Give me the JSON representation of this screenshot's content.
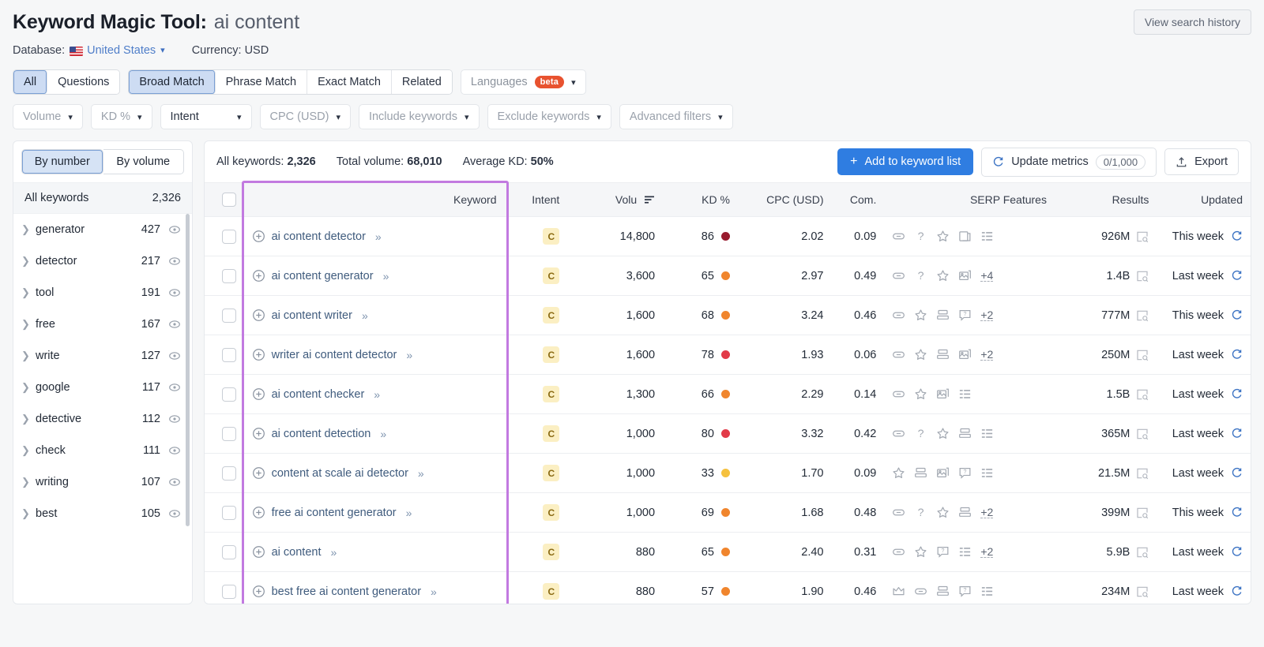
{
  "header": {
    "title_main": "Keyword Magic Tool:",
    "title_query": "ai content",
    "database_label": "Database:",
    "database_value": "United States",
    "currency_label": "Currency: USD",
    "search_history_button": "View search history",
    "flag_icon": "us-flag-icon"
  },
  "filters": {
    "match_tabs": [
      {
        "label": "All",
        "active": true
      },
      {
        "label": "Questions",
        "active": false
      }
    ],
    "match_types": [
      {
        "label": "Broad Match",
        "active": true
      },
      {
        "label": "Phrase Match",
        "active": false
      },
      {
        "label": "Exact Match",
        "active": false
      },
      {
        "label": "Related",
        "active": false
      }
    ],
    "languages": {
      "label": "Languages",
      "badge": "beta"
    },
    "dropdowns": [
      {
        "label": "Volume"
      },
      {
        "label": "KD %"
      },
      {
        "label": "Intent"
      },
      {
        "label": "CPC (USD)"
      },
      {
        "label": "Include keywords"
      },
      {
        "label": "Exclude keywords"
      },
      {
        "label": "Advanced filters"
      }
    ]
  },
  "sidebar": {
    "toggle": [
      {
        "label": "By number",
        "active": true
      },
      {
        "label": "By volume",
        "active": false
      }
    ],
    "all_keywords_label": "All keywords",
    "all_keywords_count": "2,326",
    "items": [
      {
        "label": "generator",
        "count": "427"
      },
      {
        "label": "detector",
        "count": "217"
      },
      {
        "label": "tool",
        "count": "191"
      },
      {
        "label": "free",
        "count": "167"
      },
      {
        "label": "write",
        "count": "127"
      },
      {
        "label": "google",
        "count": "117"
      },
      {
        "label": "detective",
        "count": "112"
      },
      {
        "label": "check",
        "count": "111"
      },
      {
        "label": "writing",
        "count": "107"
      },
      {
        "label": "best",
        "count": "105"
      }
    ]
  },
  "toolbar": {
    "all_keywords_label": "All keywords:",
    "all_keywords_value": "2,326",
    "total_volume_label": "Total volume:",
    "total_volume_value": "68,010",
    "average_kd_label": "Average KD:",
    "average_kd_value": "50%",
    "add_to_list_label": "Add to keyword list",
    "update_metrics_label": "Update metrics",
    "update_metrics_count": "0/1,000",
    "export_label": "Export"
  },
  "table": {
    "columns": {
      "keyword": "Keyword",
      "intent": "Intent",
      "volume": "Volu",
      "kd": "KD %",
      "cpc": "CPC (USD)",
      "com": "Com.",
      "serp": "SERP Features",
      "results": "Results",
      "updated": "Updated"
    },
    "sorted_column": "volume",
    "sort_direction": "desc",
    "rows": [
      {
        "keyword": "ai content detector",
        "intent": "C",
        "volume": "14,800",
        "kd": "86",
        "kd_color": "#981b2e",
        "cpc": "2.02",
        "com": "0.09",
        "serp": [
          "link",
          "question",
          "star",
          "snippet",
          "list"
        ],
        "serp_more": "",
        "results": "926M",
        "updated": "This week"
      },
      {
        "keyword": "ai content generator",
        "intent": "C",
        "volume": "3,600",
        "kd": "65",
        "kd_color": "#f0852d",
        "cpc": "2.97",
        "com": "0.49",
        "serp": [
          "link",
          "question",
          "star",
          "image"
        ],
        "serp_more": "+4",
        "results": "1.4B",
        "updated": "Last week"
      },
      {
        "keyword": "ai content writer",
        "intent": "C",
        "volume": "1,600",
        "kd": "68",
        "kd_color": "#f0852d",
        "cpc": "3.24",
        "com": "0.46",
        "serp": [
          "link",
          "star",
          "carousel",
          "review"
        ],
        "serp_more": "+2",
        "results": "777M",
        "updated": "This week"
      },
      {
        "keyword": "writer ai content detector",
        "intent": "C",
        "volume": "1,600",
        "kd": "78",
        "kd_color": "#e23a48",
        "cpc": "1.93",
        "com": "0.06",
        "serp": [
          "link",
          "star",
          "carousel",
          "image"
        ],
        "serp_more": "+2",
        "results": "250M",
        "updated": "Last week"
      },
      {
        "keyword": "ai content checker",
        "intent": "C",
        "volume": "1,300",
        "kd": "66",
        "kd_color": "#f0852d",
        "cpc": "2.29",
        "com": "0.14",
        "serp": [
          "link",
          "star",
          "image",
          "list"
        ],
        "serp_more": "",
        "results": "1.5B",
        "updated": "Last week"
      },
      {
        "keyword": "ai content detection",
        "intent": "C",
        "volume": "1,000",
        "kd": "80",
        "kd_color": "#e23a48",
        "cpc": "3.32",
        "com": "0.42",
        "serp": [
          "link",
          "question",
          "star",
          "carousel",
          "list"
        ],
        "serp_more": "",
        "results": "365M",
        "updated": "Last week"
      },
      {
        "keyword": "content at scale ai detector",
        "intent": "C",
        "volume": "1,000",
        "kd": "33",
        "kd_color": "#f5c13e",
        "cpc": "1.70",
        "com": "0.09",
        "serp": [
          "star",
          "carousel",
          "image",
          "review",
          "list"
        ],
        "serp_more": "",
        "results": "21.5M",
        "updated": "Last week"
      },
      {
        "keyword": "free ai content generator",
        "intent": "C",
        "volume": "1,000",
        "kd": "69",
        "kd_color": "#f0852d",
        "cpc": "1.68",
        "com": "0.48",
        "serp": [
          "link",
          "question",
          "star",
          "carousel"
        ],
        "serp_more": "+2",
        "results": "399M",
        "updated": "This week"
      },
      {
        "keyword": "ai content",
        "intent": "C",
        "volume": "880",
        "kd": "65",
        "kd_color": "#f0852d",
        "cpc": "2.40",
        "com": "0.31",
        "serp": [
          "link",
          "star",
          "review",
          "list"
        ],
        "serp_more": "+2",
        "results": "5.9B",
        "updated": "Last week"
      },
      {
        "keyword": "best free ai content generator",
        "intent": "C",
        "volume": "880",
        "kd": "57",
        "kd_color": "#f0852d",
        "cpc": "1.90",
        "com": "0.46",
        "serp": [
          "featured",
          "link",
          "carousel",
          "review",
          "list"
        ],
        "serp_more": "",
        "results": "234M",
        "updated": "Last week"
      }
    ]
  },
  "annotation": {
    "highlight_color": "#c27ae0",
    "highlight_target": "keyword-column"
  }
}
